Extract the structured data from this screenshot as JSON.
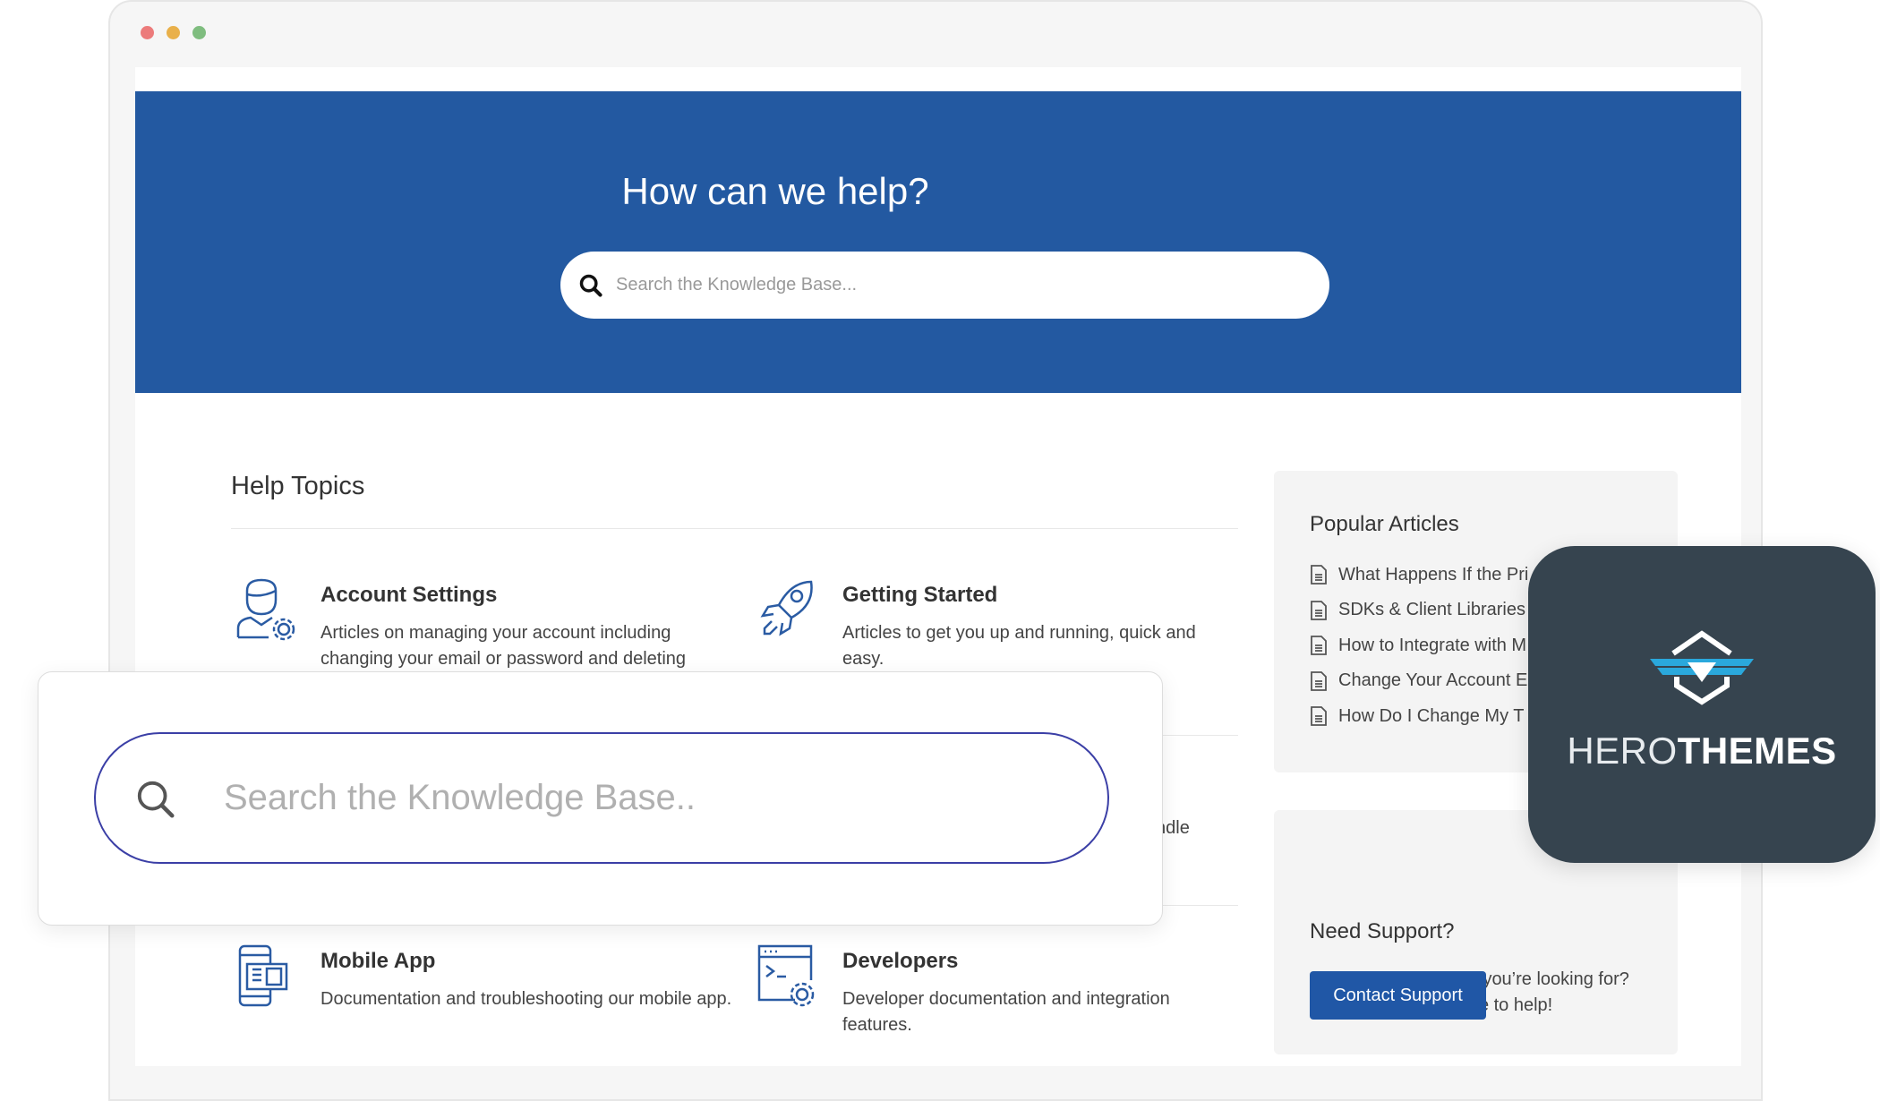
{
  "window": {
    "controls": {
      "close_color": "#ec7b7b",
      "minimize_color": "#e9b04a",
      "zoom_color": "#7fbd7f"
    }
  },
  "hero": {
    "title": "How can we help?",
    "search_placeholder": "Search the Knowledge Base...",
    "bg_color": "#2359a1"
  },
  "help_topics": {
    "heading": "Help Topics",
    "topics": [
      {
        "title": "Account Settings",
        "description": "Articles on managing your account including changing your email or password and deleting",
        "icon": "user-gear-icon"
      },
      {
        "title": "Getting Started",
        "description": "Articles to get you up and running, quick and easy.",
        "icon": "rocket-icon"
      },
      {
        "fragment": "ndle"
      },
      {
        "title": "Mobile App",
        "description": "Documentation and troubleshooting our mobile app.",
        "icon": "mobile-app-icon"
      },
      {
        "title": "Developers",
        "description": "Developer documentation and integration features.",
        "icon": "code-window-gear-icon"
      }
    ]
  },
  "sidebar": {
    "popular": {
      "title": "Popular Articles",
      "items": [
        "What Happens If the Pri",
        "SDKs & Client Libraries",
        "How to Integrate with M",
        "Change Your Account E",
        "How Do I Change My T"
      ]
    },
    "support": {
      "title": "Need Support?",
      "text_line1": "Can’t find the answer you’re looking for?",
      "text_line2": "Don’t worry we’re here to help!",
      "button": "Contact Support"
    }
  },
  "overlay_search": {
    "placeholder": "Search the Knowledge Base.."
  },
  "badge": {
    "brand_light": "HERO",
    "brand_bold": "THEMES",
    "bg_color": "#36444f",
    "accent": "#2aa8dc"
  }
}
